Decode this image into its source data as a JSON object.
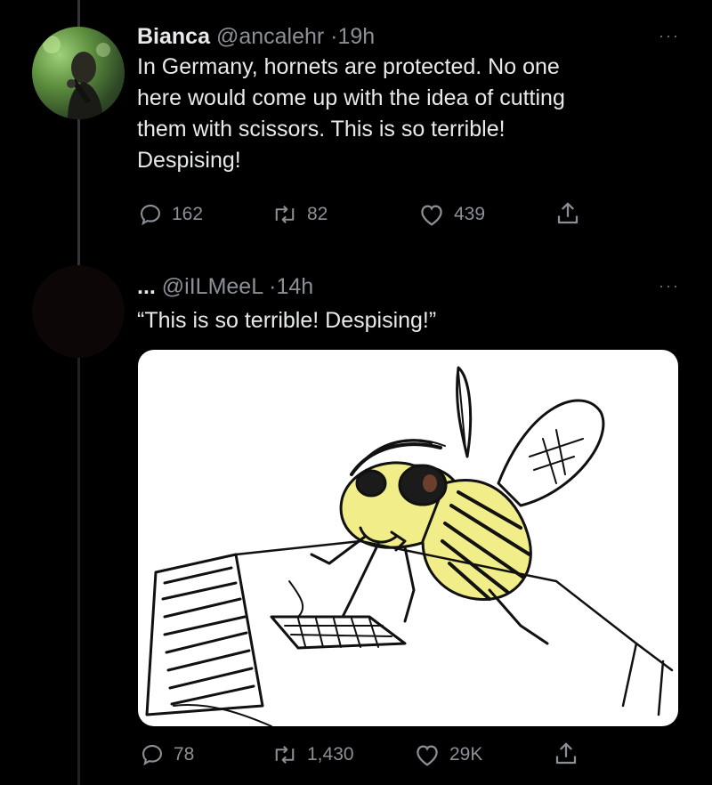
{
  "tweet1": {
    "name": "Bianca",
    "handle": "@ancalehr",
    "separator": "·",
    "time": "19h",
    "more": "···",
    "text_lines": [
      "In Germany, hornets are protected. No one",
      "here would come up with the idea of cutting",
      "them with scissors. This is so terrible!",
      "Despising!"
    ],
    "replies": "162",
    "retweets": "82",
    "likes": "439"
  },
  "tweet2": {
    "name": "...",
    "handle": "@iILMeeL",
    "separator": "·",
    "time": "14h",
    "more": "···",
    "text": "“This is so terrible! Despising!”",
    "replies": "78",
    "retweets": "1,430",
    "likes": "29K"
  },
  "icons": {
    "reply": "reply-icon",
    "retweet": "retweet-icon",
    "like": "heart-icon",
    "share": "share-icon"
  },
  "colors": {
    "background": "#000000",
    "text": "#e7e9ea",
    "muted": "#8b9096",
    "bee_yellow": "#f1ee8a"
  }
}
